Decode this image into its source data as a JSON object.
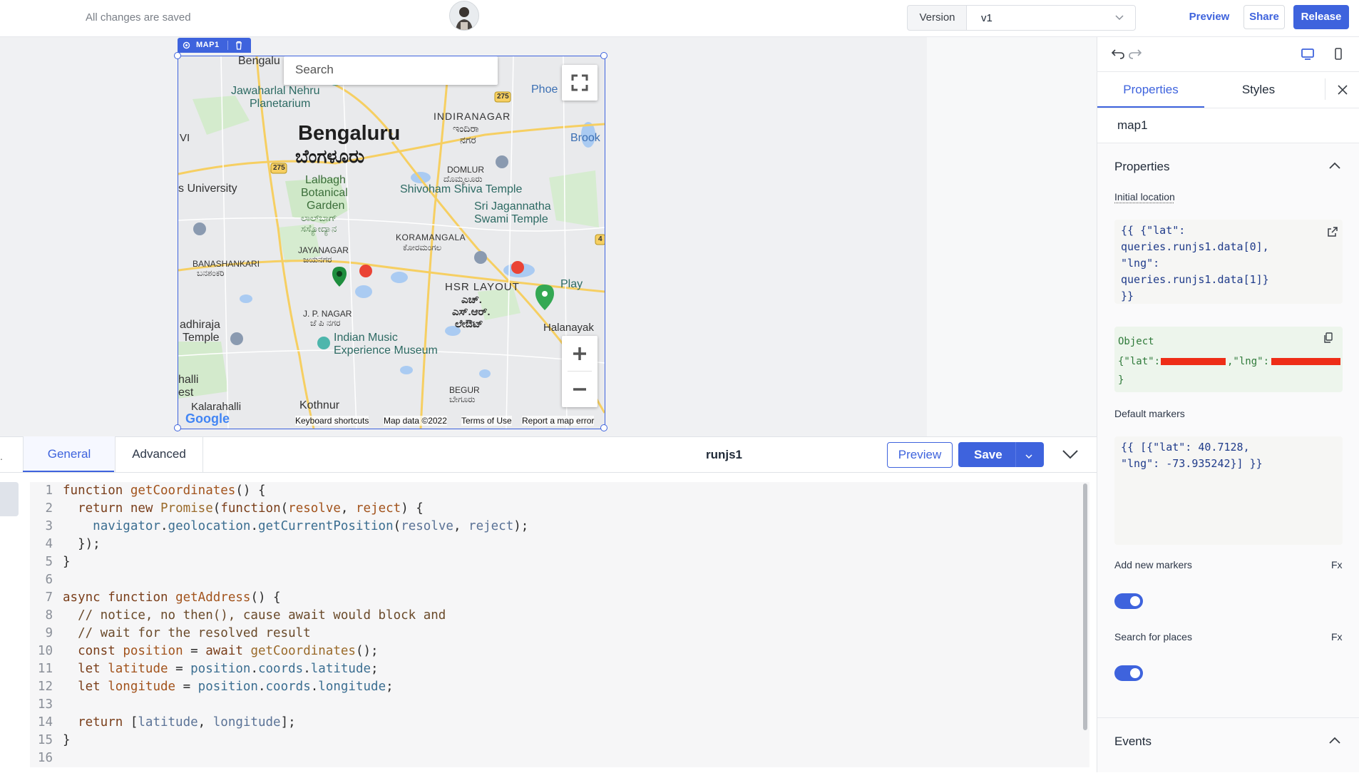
{
  "topbar": {
    "save_status": "All changes are saved",
    "version_label": "Version",
    "version_value": "v1",
    "preview_label": "Preview",
    "share_label": "Share",
    "release_label": "Release"
  },
  "map_widget": {
    "tag_label": "MAP1",
    "search_placeholder": "Search",
    "labels": {
      "bengalu_top": "Bengalu",
      "jawaharlal": "Jawaharlal Nehru",
      "planetarium": "Planetarium",
      "phoe": "Phoe",
      "indiranagar": "INDIRANAGAR",
      "indiranagar_kn": "ಇಂದಿರಾ",
      "indiranagar_kn2": "ನಗರ",
      "bengaluru": "Bengaluru",
      "bengaluru_kn": "ಬೆಂಗಳೂರು",
      "brook": "Brook",
      "vi": "VI",
      "domlur": "DOMLUR",
      "domlur_kn": "ದೊಮ್ಮಲೂರು",
      "university": "s University",
      "lalbagh1": "Lalbagh",
      "lalbagh2": "Botanical",
      "lalbagh3": "Garden",
      "lalbagh_kn1": "ಲಾಲ್‌ಬಾಗ್",
      "lalbagh_kn2": "ಸಸ್ಯೋದ್ಯಾನ",
      "shivoham": "Shivoham Shiva Temple",
      "jagannatha1": "Sri Jagannatha",
      "jagannatha2": "Swami Temple",
      "koramangala": "KORAMANGALA",
      "koramangala_kn": "ಕೋರಮಂಗಲ",
      "jayanagar": "JAYANAGAR",
      "jayanagar_kn": "ಜಯನಗರ",
      "banashankari": "BANASHANKARI",
      "banashankari_kn": "ಬನಶಂಕರಿ",
      "hsr": "HSR LAYOUT",
      "hsr_kn1": "ಎಚ್.",
      "hsr_kn2": "ಎಸ್.ಆರ್.",
      "hsr_kn3": "ಲೇಔಟ್",
      "play": "Play",
      "jp_nagar": "J. P. NAGAR",
      "jp_nagar_kn": "ಜೆ ಪಿ ನಗರ",
      "adhiraja": "adhiraja",
      "temple": "Temple",
      "music1": "Indian Music",
      "music2": "Experience Museum",
      "halanayak": "Halanayak",
      "halli": "halli",
      "est": "est",
      "begur": "BEGUR",
      "begur_kn": "ಬೇಗೂರು",
      "kothnur": "Kothnur",
      "kalahalli": "Kalarahalli",
      "r275a": "275",
      "r275b": "275",
      "r4": "4"
    },
    "footer": {
      "shortcuts": "Keyboard shortcuts",
      "data": "Map data ©2022",
      "terms": "Terms of Use",
      "report": "Report a map error",
      "google": "Google"
    }
  },
  "query_panel": {
    "tabs": [
      "General",
      "Advanced"
    ],
    "query_name": "runjs1",
    "preview_label": "Preview",
    "save_label": "Save",
    "code_lines": [
      "function getCoordinates() {",
      "  return new Promise(function(resolve, reject) {",
      "    navigator.geolocation.getCurrentPosition(resolve, reject);",
      "  });",
      "}",
      "",
      "async function getAddress() {",
      "  // notice, no then(), cause await would block and",
      "  // wait for the resolved result",
      "  const position = await getCoordinates();",
      "  let latitude = position.coords.latitude;",
      "  let longitude = position.coords.longitude;",
      "",
      "  return [latitude, longitude];",
      "}",
      ""
    ]
  },
  "inspector": {
    "tabs": [
      "Properties",
      "Styles"
    ],
    "widget_name": "map1",
    "section_properties": "Properties",
    "initial_location_label": "Initial location",
    "initial_location_code": "{{ {\"lat\":\nqueries.runjs1.data[0],\n\"lng\":\nqueries.runjs1.data[1]}\n}}",
    "object_label": "Object",
    "object_value": "{\"lat\":",
    "object_value_mid": ",\"lng\":",
    "object_value_end": "}",
    "default_markers_label": "Default markers",
    "default_markers_code": "{{ [{\"lat\": 40.7128,\n\"lng\": -73.935242}] }}",
    "add_markers_label": "Add new markers",
    "add_markers_fx": "Fx",
    "add_markers_on": true,
    "search_places_label": "Search for places",
    "search_places_fx": "Fx",
    "search_places_on": true,
    "section_events": "Events"
  },
  "colors": {
    "accent": "#3e63dd",
    "redaction": "#ee2d17",
    "map_marker_green": "#34a853",
    "map_marker_red": "#ea4335"
  }
}
